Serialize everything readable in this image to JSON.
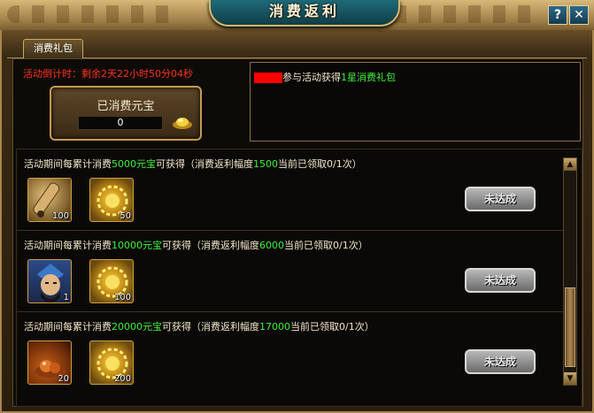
{
  "window": {
    "title": "消费返利",
    "help_label": "?",
    "close_label": "✕"
  },
  "tabs": [
    {
      "label": "消费礼包",
      "active": true
    }
  ],
  "countdown": {
    "label": "活动倒计时：",
    "value": "剩余2天22小时50分04秒"
  },
  "spent": {
    "label": "已消费元宝",
    "value": "0",
    "icon": "gold-ingot-icon"
  },
  "message": {
    "text_before": "参与活动获得",
    "highlight": "1星消费礼包"
  },
  "items": [
    {
      "prefix": "活动期间每累计消费",
      "amount": "5000元宝",
      "middle": "可获得（消费返利幅度",
      "rebate": "1500",
      "suffix": "当前已领取0/1次）",
      "rewards": [
        {
          "icon": "scroll-icon",
          "qty": "100"
        },
        {
          "icon": "gold-coin-pile-icon",
          "qty": "50"
        }
      ],
      "status": "未达成"
    },
    {
      "prefix": "活动期间每累计消费",
      "amount": "10000元宝",
      "middle": "可获得（消费返利幅度",
      "rebate": "6000",
      "suffix": "当前已领取0/1次）",
      "rewards": [
        {
          "icon": "hero-portrait-icon",
          "qty": "1"
        },
        {
          "icon": "gold-coin-pile-icon",
          "qty": "100"
        }
      ],
      "status": "未达成"
    },
    {
      "prefix": "活动期间每累计消费",
      "amount": "20000元宝",
      "middle": "可获得（消费返利幅度",
      "rebate": "17000",
      "suffix": "当前已领取0/1次）",
      "rewards": [
        {
          "icon": "orb-icon",
          "qty": "20"
        },
        {
          "icon": "gold-coin-pile-icon",
          "qty": "200"
        }
      ],
      "status": "未达成"
    }
  ],
  "scroll": {
    "up_label": "▲",
    "down_label": "▼"
  }
}
